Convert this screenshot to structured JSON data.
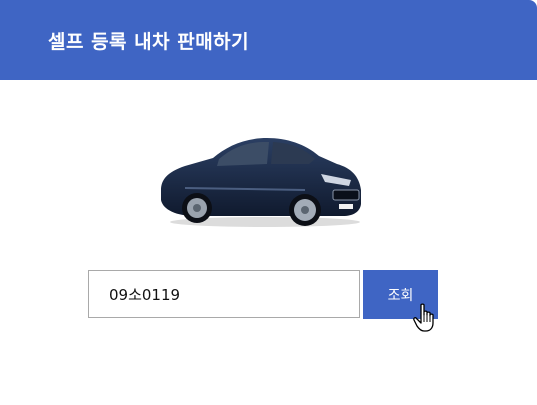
{
  "header": {
    "title": "셀프 등록 내차 판매하기"
  },
  "search": {
    "value": "09소0119",
    "button_label": "조회"
  },
  "colors": {
    "accent": "#3f65c4",
    "car_body": "#1b2c4a"
  },
  "icons": {
    "car": "car-image",
    "cursor": "hand-pointer-icon"
  }
}
